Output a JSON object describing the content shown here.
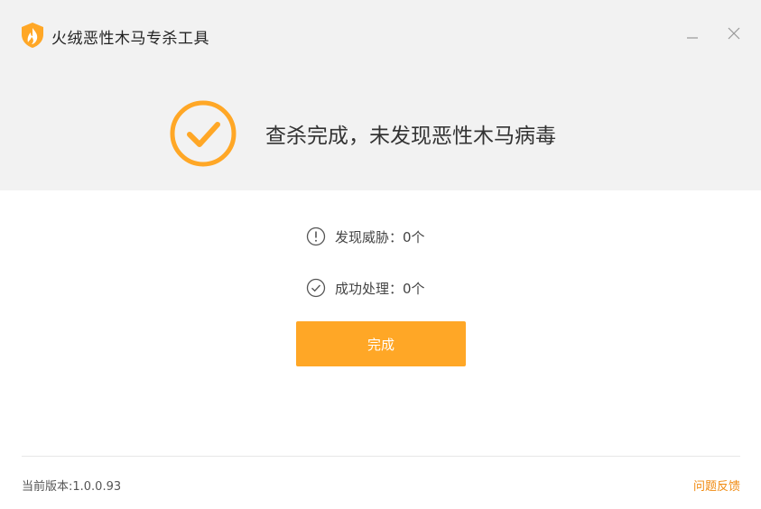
{
  "app": {
    "title": "火绒恶性木马专杀工具",
    "accent_color": "#ffa726"
  },
  "window_controls": {
    "minimize_icon": "minimize-icon",
    "close_icon": "close-icon"
  },
  "result": {
    "icon": "check-circle-icon",
    "message": "查杀完成，未发现恶性木马病毒"
  },
  "stats": [
    {
      "icon": "exclamation-circle-icon",
      "label": "发现威胁：",
      "value": "0个"
    },
    {
      "icon": "check-circle-outline-icon",
      "label": "成功处理：",
      "value": "0个"
    }
  ],
  "actions": {
    "done_label": "完成"
  },
  "footer": {
    "version": "当前版本:1.0.0.93",
    "feedback_label": "问题反馈",
    "feedback_color": "#f08a10"
  }
}
